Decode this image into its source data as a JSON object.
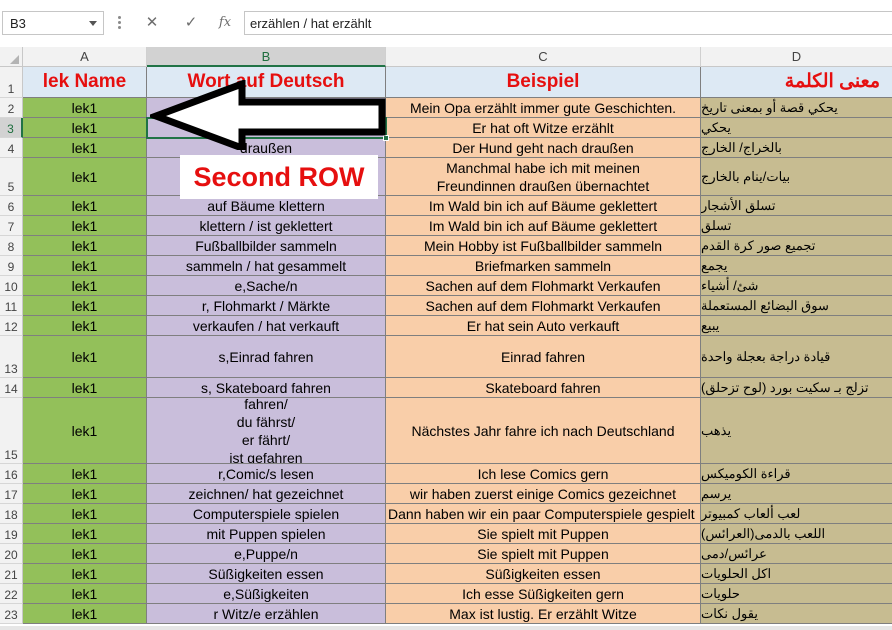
{
  "formula_bar": {
    "name_box": "B3",
    "cancel_icon": "✕",
    "enter_icon": "✓",
    "fx_label": "fx",
    "formula": "erzählen / hat erzählt"
  },
  "columns": [
    "A",
    "B",
    "C",
    "D"
  ],
  "header_row": {
    "number": "1",
    "a": "lek Name",
    "b": "Wort auf Deutsch",
    "c": "Beispiel",
    "d": "معنى الكلمة"
  },
  "rows": [
    {
      "n": "2",
      "a": "lek1",
      "b": "",
      "c": "Mein Opa erzählt immer gute Geschichten.",
      "d": "يحكي قصة أو بمعنى تاريخ"
    },
    {
      "n": "3",
      "a": "lek1",
      "b": "erzählen / hat erzählt",
      "c": "Er  hat oft Witze erzählt",
      "d": "يحكي"
    },
    {
      "n": "4",
      "a": "lek1",
      "b": "draußen",
      "c": "Der Hund geht nach draußen",
      "d": "بالخراج/ الخارج"
    },
    {
      "n": "5",
      "a": "lek1",
      "b": "",
      "c": "Manchmal habe ich mit meinen\nFreundinnen draußen übernachtet",
      "d": "بيات/ينام بالخارج"
    },
    {
      "n": "6",
      "a": "lek1",
      "b": "auf Bäume klettern",
      "c": "Im Wald bin ich auf Bäume geklettert",
      "d": "تسلق الأشجار"
    },
    {
      "n": "7",
      "a": "lek1",
      "b": "klettern / ist geklettert",
      "c": "Im Wald bin ich auf Bäume geklettert",
      "d": "تسلق"
    },
    {
      "n": "8",
      "a": "lek1",
      "b": "Fußballbilder sammeln",
      "c": "Mein Hobby ist Fußballbilder sammeln",
      "d": "تجميع صور كرة القدم"
    },
    {
      "n": "9",
      "a": "lek1",
      "b": "sammeln / hat gesammelt",
      "c": "Briefmarken sammeln",
      "d": "يجمع"
    },
    {
      "n": "10",
      "a": "lek1",
      "b": "e,Sache/n",
      "c": "Sachen auf dem Flohmarkt Verkaufen",
      "d": "شئ/ أشياء"
    },
    {
      "n": "11",
      "a": "lek1",
      "b": "r, Flohmarkt / Märkte",
      "c": "Sachen auf dem Flohmarkt Verkaufen",
      "d": "سوق البضائع المستعملة"
    },
    {
      "n": "12",
      "a": "lek1",
      "b": "verkaufen / hat verkauft",
      "c": "Er hat sein Auto verkauft",
      "d": "يبيع"
    },
    {
      "n": "13",
      "a": "lek1",
      "b": "s,Einrad fahren",
      "c": "Einrad fahren",
      "d": "قيادة دراجة بعجلة واحدة"
    },
    {
      "n": "14",
      "a": "lek1",
      "b": "s, Skateboard fahren",
      "c": "Skateboard fahren",
      "d": "تزلج بـ سكيت بورد (لوح تزحلق)"
    },
    {
      "n": "15",
      "a": "lek1",
      "b": "fahren/\ndu fährst/\ner fährt/\nist gefahren",
      "c": "Nächstes Jahr fahre ich nach Deutschland",
      "d": "يذهب"
    },
    {
      "n": "16",
      "a": "lek1",
      "b": "r,Comic/s lesen",
      "c": "Ich lese Comics gern",
      "d": "قراءة الكوميكس"
    },
    {
      "n": "17",
      "a": "lek1",
      "b": "zeichnen/ hat gezeichnet",
      "c": "wir haben zuerst einige Comics gezeichnet",
      "d": "يرسم"
    },
    {
      "n": "18",
      "a": "lek1",
      "b": "Computerspiele spielen",
      "c": "Dann haben wir ein paar Computerspiele gespielt",
      "d": "لعب ألعاب كمبيوتر"
    },
    {
      "n": "19",
      "a": "lek1",
      "b": "mit Puppen spielen",
      "c": "Sie spielt mit Puppen",
      "d": "اللعب بالدمى(العرائس)"
    },
    {
      "n": "20",
      "a": "lek1",
      "b": "e,Puppe/n",
      "c": "Sie spielt mit Puppen",
      "d": "عرائس/دمى"
    },
    {
      "n": "21",
      "a": "lek1",
      "b": "Süßigkeiten essen",
      "c": "Süßigkeiten essen",
      "d": "اكل الحلويات"
    },
    {
      "n": "22",
      "a": "lek1",
      "b": "e,Süßigkeiten",
      "c": "Ich esse Süßigkeiten gern",
      "d": "حلويات"
    },
    {
      "n": "23",
      "a": "lek1",
      "b": "r Witz/e erzählen",
      "c": "Max ist lustig. Er erzählt Witze",
      "d": "يقول نكات"
    }
  ],
  "overlay": {
    "label": "Second ROW",
    "label_color": "#e60f0f",
    "arrow_icon": "left-arrow-icon"
  },
  "colors": {
    "col_a": "#93c05a",
    "col_b": "#c9bedb",
    "col_c": "#f9cea9",
    "col_d": "#c7bc91",
    "header_bg": "#dde9f4",
    "accent": "#217346"
  }
}
